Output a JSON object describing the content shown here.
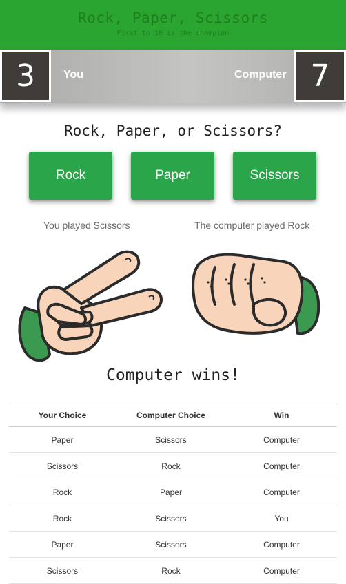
{
  "header": {
    "title": "Rock, Paper, Scissors",
    "subtitle": "First to 10 is the champion"
  },
  "score": {
    "you_label": "You",
    "computer_label": "Computer",
    "you_score": "3",
    "computer_score": "7"
  },
  "prompt": "Rock, Paper, or Scissors?",
  "buttons": {
    "rock": "Rock",
    "paper": "Paper",
    "scissors": "Scissors"
  },
  "played": {
    "you": "You played Scissors",
    "computer": "The computer played Rock"
  },
  "hands": {
    "you": "scissors-hand-icon",
    "computer": "rock-fist-icon"
  },
  "result": "Computer wins!",
  "history": {
    "headers": [
      "Your Choice",
      "Computer Choice",
      "Win"
    ],
    "rows": [
      [
        "Paper",
        "Scissors",
        "Computer"
      ],
      [
        "Scissors",
        "Rock",
        "Computer"
      ],
      [
        "Rock",
        "Paper",
        "Computer"
      ],
      [
        "Rock",
        "Scissors",
        "You"
      ],
      [
        "Paper",
        "Scissors",
        "Computer"
      ],
      [
        "Scissors",
        "Rock",
        "Computer"
      ]
    ]
  },
  "colors": {
    "header_green": "#2aa52f",
    "button_green": "#2aa54a",
    "score_box": "#403c38",
    "skin": "#f7d4ba",
    "sleeve": "#3b9a4f"
  }
}
